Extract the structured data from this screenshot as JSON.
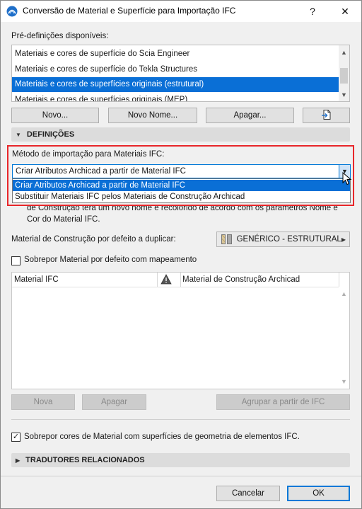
{
  "window": {
    "title": "Conversão de Material e Superfície para Importação IFC",
    "help_glyph": "?",
    "close_glyph": "✕"
  },
  "presets": {
    "label": "Pré-definições disponíveis:",
    "items": [
      "Materiais e cores de superfície do Scia Engineer",
      "Materiais e cores de superfície do Tekla Structures",
      "Materiais e cores de superfícies originais (estrutural)",
      "Materiais e cores de superfícies originais (MEP)"
    ],
    "selected_index": 2,
    "buttons": {
      "new": "Novo...",
      "new_name": "Novo Nome...",
      "delete": "Apagar..."
    }
  },
  "sections": {
    "definitions": "DEFINIÇÕES",
    "related_translators": "TRADUTORES RELACIONADOS"
  },
  "import_method": {
    "label": "Método de importação para Materiais IFC:",
    "value": "Criar Atributos Archicad a partir de Material IFC",
    "options": [
      "Criar Atributos Archicad a partir de Material IFC",
      "Substituir Materiais IFC pelos Materiais de Construção Archicad"
    ],
    "selected_index": 0,
    "description_line1": "de Construção terá um novo nome e recolorido de acordo com os parâmetros Nome e",
    "description_line2": "Cor do Material IFC."
  },
  "default_material": {
    "label": "Material de Construção por defeito a duplicar:",
    "value": "GENÉRICO - ESTRUTURAL"
  },
  "override_mapping": {
    "label": "Sobrepor Material por defeito com mapeamento",
    "checked": false
  },
  "mapping_table": {
    "col_ifc": "Material IFC",
    "col_archicad": "Material de Construção Archicad",
    "rows": []
  },
  "table_buttons": {
    "new": "Nova",
    "delete": "Apagar",
    "group": "Agrupar a partir de IFC"
  },
  "override_colors": {
    "label": "Sobrepor cores de Material com superfícies de geometria de elementos IFC.",
    "checked": true
  },
  "footer": {
    "cancel": "Cancelar",
    "ok": "OK"
  },
  "colors": {
    "selection": "#0a6fd6",
    "highlight_border": "#e8262a",
    "accent": "#0078d7"
  }
}
